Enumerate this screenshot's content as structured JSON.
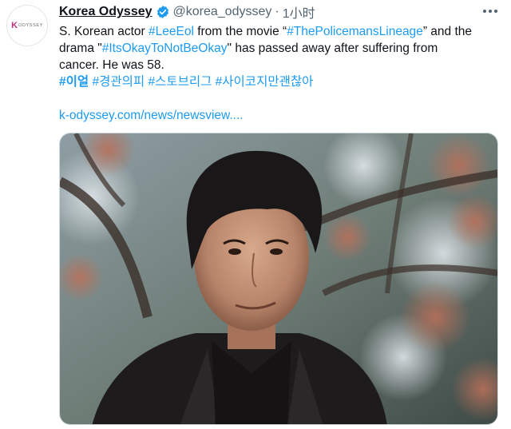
{
  "avatar": {
    "brand_mark": "K",
    "brand_text": "ODYSSEY"
  },
  "header": {
    "display_name": "Korea Odyssey",
    "handle": "@korea_odyssey",
    "separator": "·",
    "time": "1小时"
  },
  "tweet": {
    "line1": {
      "a": "S. Korean actor ",
      "b": "#LeeEol",
      "c": " from the movie “",
      "d": "#ThePolicemansLineage",
      "e": "” and the"
    },
    "line2": {
      "a": "drama \"",
      "b": "#ItsOkayToNotBeOkay",
      "c": "\" has passed away after suffering from"
    },
    "line3": "cancer. He was 58.",
    "tags": [
      "#이얼",
      "#경관의피",
      "#스토브리그",
      "#사이코지만괜찮아"
    ],
    "link": "k-odyssey.com/news/newsview...."
  },
  "colors": {
    "link": "#1d9bf0",
    "text": "#0f1419",
    "muted": "#536471",
    "verified": "#1d9bf0"
  },
  "icons": {
    "verified": "verified-badge-icon",
    "more": "more-horizontal-icon"
  }
}
